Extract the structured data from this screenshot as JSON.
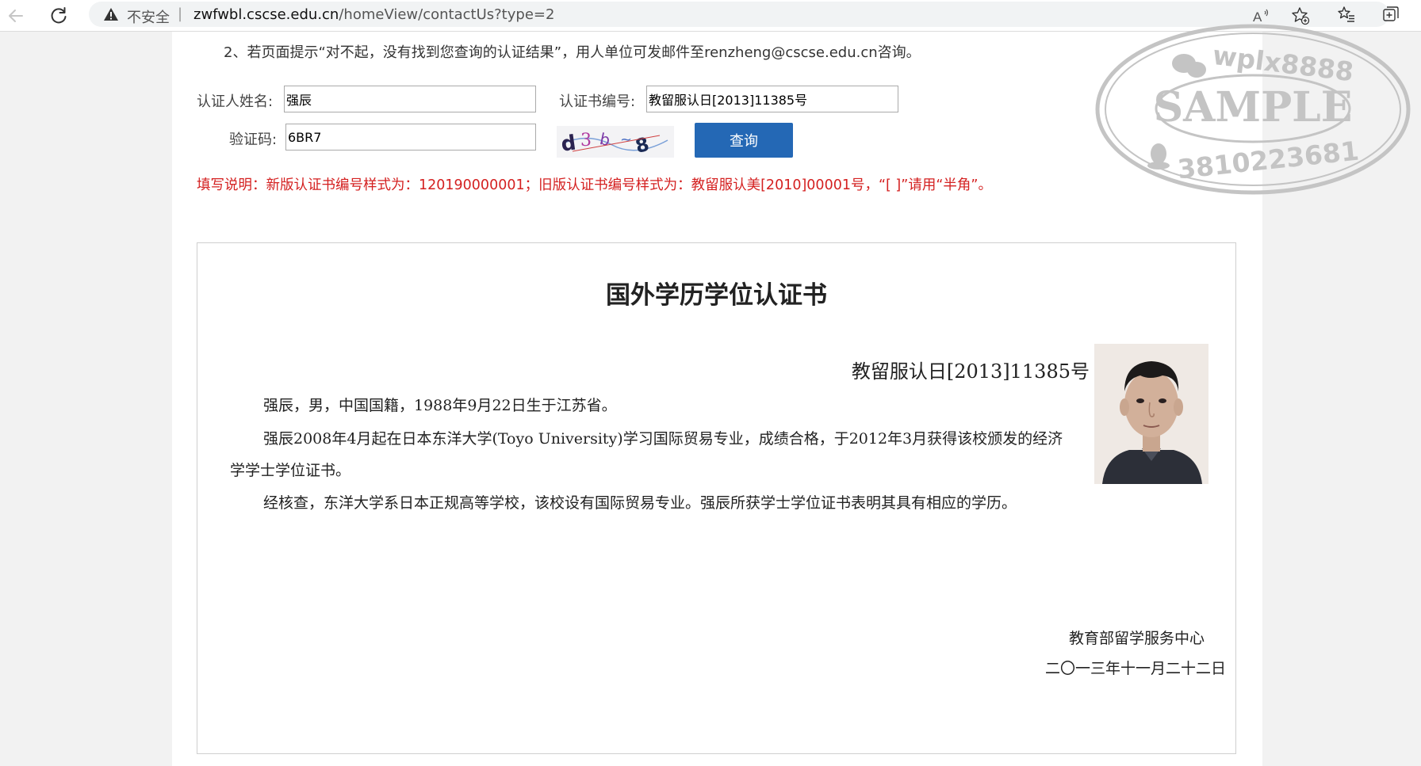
{
  "browser": {
    "security_label": "不安全",
    "url_separator": "|",
    "url_host": "zwfwbl.cscse.edu.cn",
    "url_path": "/homeView/contactUs?type=2",
    "icons": [
      "back-arrow-icon",
      "reload-icon",
      "warning-icon",
      "read-aloud-icon",
      "add-favorite-icon",
      "favorites-icon",
      "collections-icon"
    ]
  },
  "page": {
    "tip": "2、若页面提示“对不起，没有找到您查询的认证结果”，用人单位可发邮件至renzheng@cscse.edu.cn咨询。",
    "form": {
      "name_label": "认证人姓名:",
      "name_value": "强辰",
      "cert_label": "认证书编号:",
      "cert_value": "教留服认日[2013]11385号",
      "captcha_label": "验证码:",
      "captcha_value": "6BR7",
      "query_button": "查询"
    },
    "note": "填写说明：新版认证书编号样式为：120190000001；旧版认证书编号样式为：教留服认美[2010]00001号，“[ ]”请用“半角”。"
  },
  "certificate": {
    "title": "国外学历学位认证书",
    "number": "教留服认日[2013]11385号",
    "para1": "强辰，男，中国国籍，1988年9月22日生于江苏省。",
    "para2a": "强辰2008年4月起在日本东洋大学(Toyo University)学习国际贸易专业，成绩合格，于2012年3月获得该校颁发的经济",
    "para2b": "学学士学位证书。",
    "para3": "经核查，东洋大学系日本正规高等学校，该校设有国际贸易专业。强辰所获学士学位证书表明其具有相应的学历。",
    "issuer": "教育部留学服务中心",
    "date": "二〇一三年十一月二十二日"
  },
  "watermark": {
    "top_text": "wplx8888",
    "center_text": "SAMPLE",
    "bottom_text": "3810223681"
  },
  "colors": {
    "accent": "#2468b5",
    "note_red": "#d42020",
    "stamp_gray": "#c4c4c4"
  }
}
